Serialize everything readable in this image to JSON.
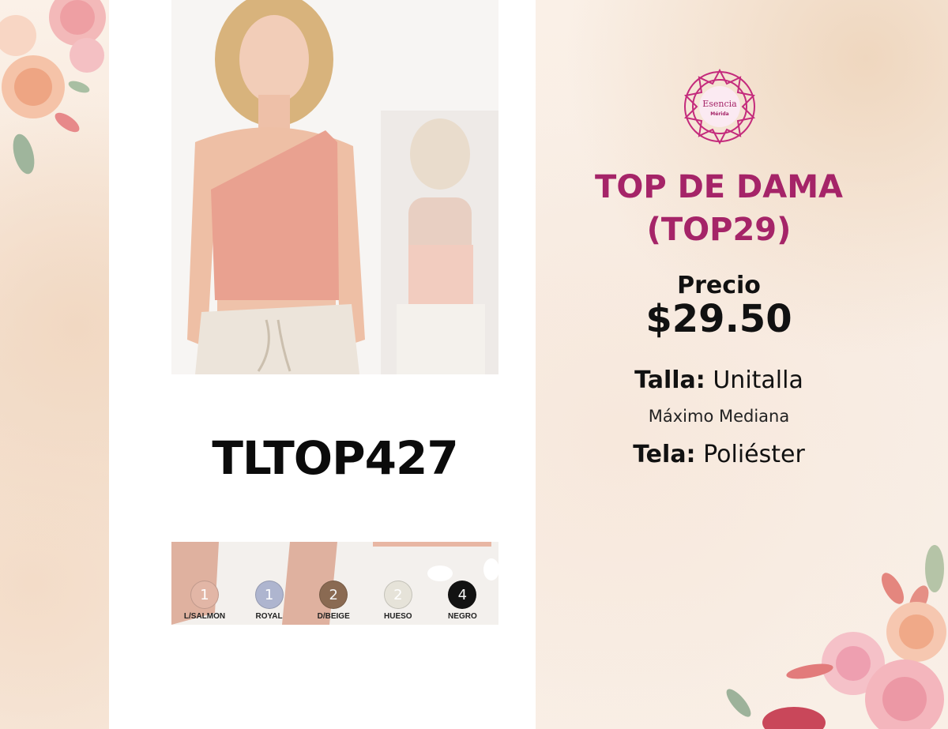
{
  "product": {
    "code": "TLTOP427",
    "title_line1": "TOP DE DAMA",
    "title_line2": "(TOP29)",
    "price_label": "Precio",
    "price": "$29.50",
    "size_label": "Talla:",
    "size_value": "Unitalla",
    "size_note": "Máximo Mediana",
    "fabric_label": "Tela:",
    "fabric_value": "Poliéster"
  },
  "brand": {
    "name": "Esencia",
    "sub": "Mérida"
  },
  "colors": {
    "accent": "#a52468",
    "garment": "#e9a190"
  },
  "swatches": [
    {
      "count": "1",
      "label": "L/SALMON",
      "color": "#e2b6a6"
    },
    {
      "count": "1",
      "label": "ROYAL",
      "color": "#aeb5cf"
    },
    {
      "count": "2",
      "label": "D/BEIGE",
      "color": "#8a6a52"
    },
    {
      "count": "2",
      "label": "HUESO",
      "color": "#e6e3d9"
    },
    {
      "count": "4",
      "label": "NEGRO",
      "color": "#121212"
    }
  ]
}
